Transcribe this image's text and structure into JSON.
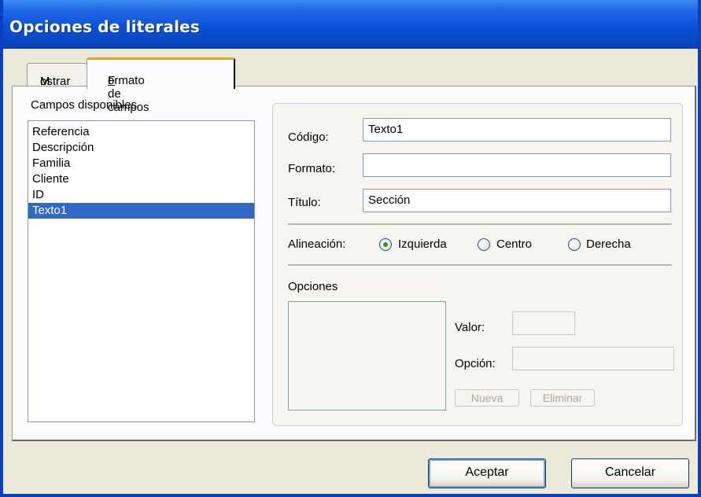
{
  "window": {
    "title": "Opciones de literales"
  },
  "tabs": [
    {
      "label": "Mostrar",
      "underline": "M",
      "rest": "ostrar"
    },
    {
      "label": "Formato de campos",
      "underline": "F",
      "rest": "ormato de campos"
    }
  ],
  "fields_list": {
    "label": "Campos disponibles",
    "items": [
      "Referencia",
      "Descripción",
      "Familia",
      "Cliente",
      "ID",
      "Texto1"
    ],
    "selected": "Texto1"
  },
  "form": {
    "codigo_label": "Código:",
    "codigo_value": "Texto1",
    "formato_label": "Formato:",
    "formato_value": "",
    "titulo_label": "Título:",
    "titulo_value": "Sección"
  },
  "alignment": {
    "label": "Alineación:",
    "options": [
      "Izquierda",
      "Centro",
      "Derecha"
    ],
    "selected": "Izquierda"
  },
  "options": {
    "label": "Opciones",
    "valor_label": "Valor:",
    "opcion_label": "Opción:",
    "nueva_button": "Nueva",
    "eliminar_button": "Eliminar"
  },
  "buttons": {
    "accept": "Aceptar",
    "cancel": "Cancelar"
  },
  "colors": {
    "titlebar": "#0a52d8",
    "selection": "#316ac5",
    "radio_dot": "#21a121",
    "tab_highlight": "#e6a32b"
  }
}
